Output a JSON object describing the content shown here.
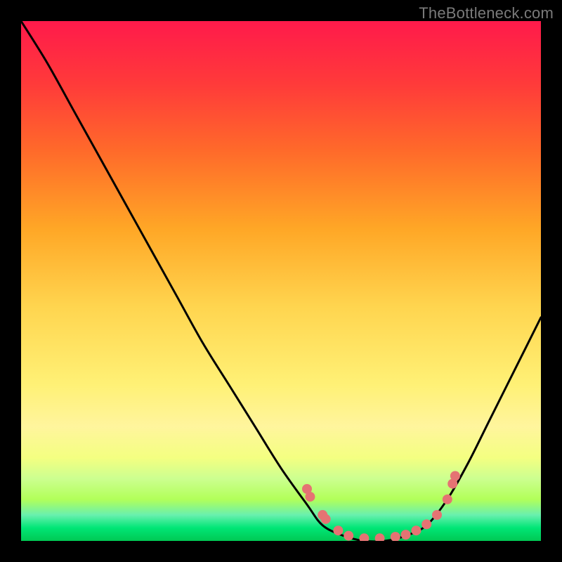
{
  "watermark": "TheBottleneck.com",
  "chart_data": {
    "type": "line",
    "title": "",
    "xlabel": "",
    "ylabel": "",
    "xlim": [
      0,
      100
    ],
    "ylim": [
      0,
      100
    ],
    "curve": {
      "name": "bottleneck-curve",
      "color": "#000000",
      "x": [
        0,
        5,
        10,
        15,
        20,
        25,
        30,
        35,
        40,
        45,
        50,
        55,
        58,
        62,
        66,
        70,
        74,
        78,
        82,
        86,
        90,
        95,
        100
      ],
      "values": [
        100,
        92,
        83,
        74,
        65,
        56,
        47,
        38,
        30,
        22,
        14,
        7,
        3,
        1,
        0,
        0,
        1,
        3,
        8,
        15,
        23,
        33,
        43
      ]
    },
    "dots": {
      "name": "data-points",
      "color": "#e57373",
      "radius": 7,
      "x": [
        55,
        55.6,
        58,
        58.6,
        61,
        63,
        66,
        69,
        72,
        74,
        76,
        78,
        80,
        82,
        83,
        83.5
      ],
      "values": [
        10,
        8.5,
        5,
        4.2,
        2,
        1,
        0.5,
        0.5,
        0.8,
        1.2,
        2,
        3.2,
        5,
        8,
        11,
        12.5
      ]
    },
    "background_gradient": {
      "stops": [
        {
          "offset": 0.0,
          "color": "#ff1a4b"
        },
        {
          "offset": 0.12,
          "color": "#ff3a3a"
        },
        {
          "offset": 0.25,
          "color": "#ff6a2a"
        },
        {
          "offset": 0.4,
          "color": "#ffa726"
        },
        {
          "offset": 0.55,
          "color": "#ffd54f"
        },
        {
          "offset": 0.7,
          "color": "#fff176"
        },
        {
          "offset": 0.78,
          "color": "#fff59d"
        },
        {
          "offset": 0.84,
          "color": "#f4ff81"
        },
        {
          "offset": 0.88,
          "color": "#ccff90"
        },
        {
          "offset": 0.92,
          "color": "#b2ff59"
        },
        {
          "offset": 0.95,
          "color": "#69f0ae"
        },
        {
          "offset": 0.975,
          "color": "#00e676"
        },
        {
          "offset": 1.0,
          "color": "#00c853"
        }
      ]
    }
  }
}
